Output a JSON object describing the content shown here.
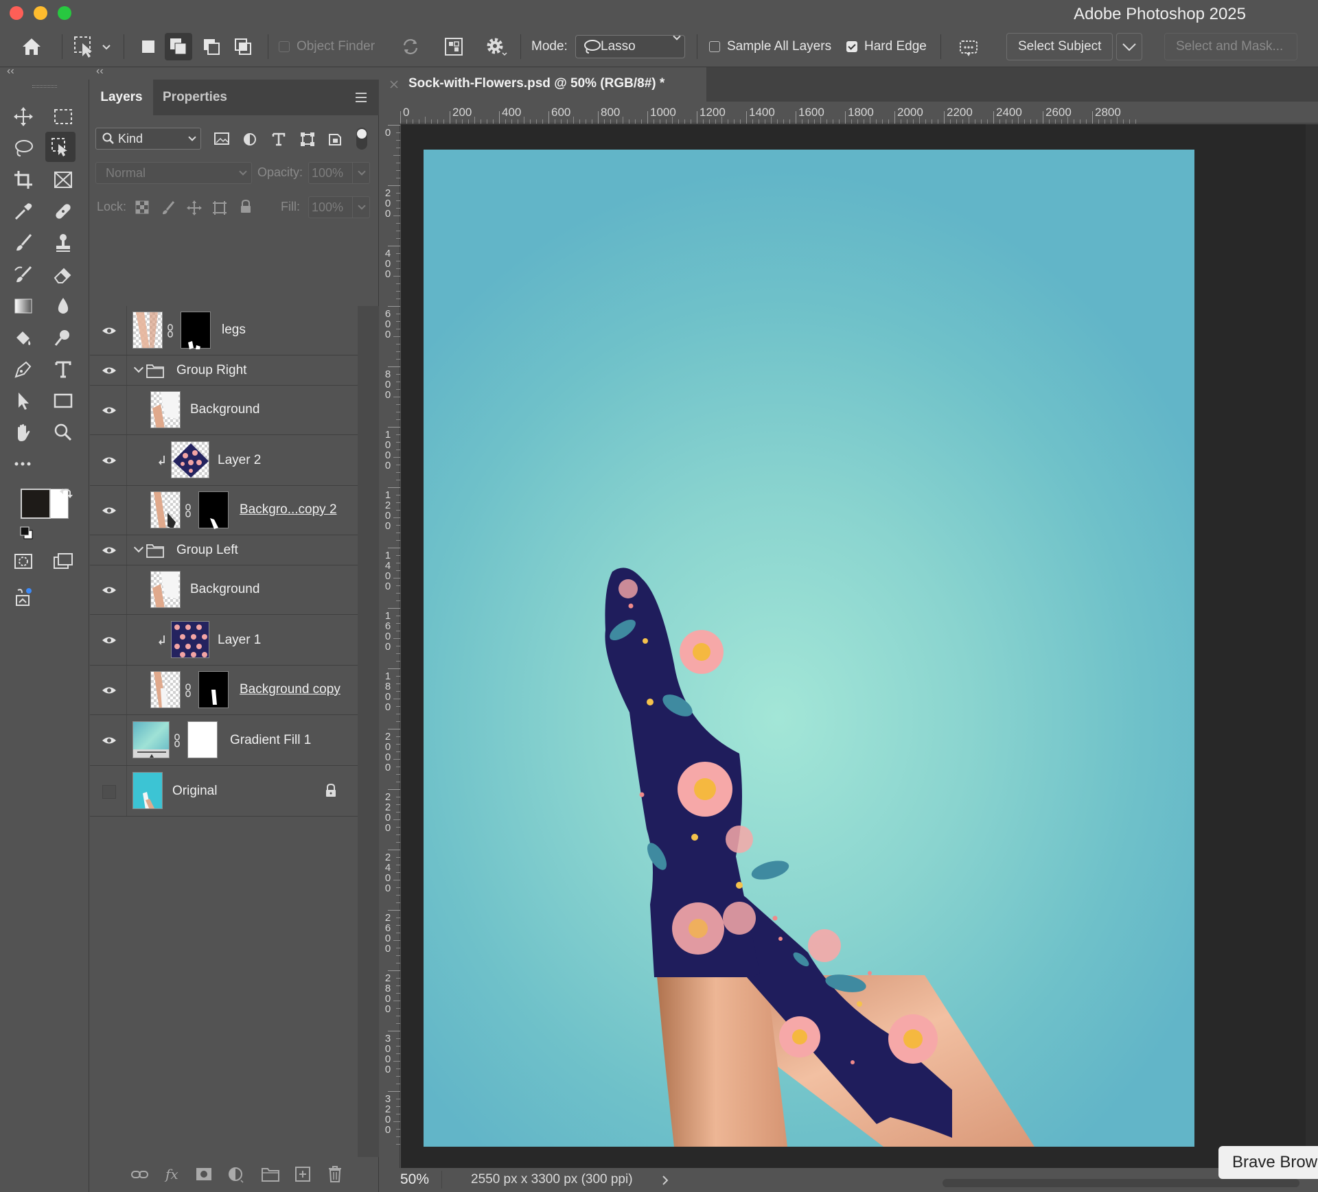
{
  "app": {
    "title": "Adobe Photoshop 2025"
  },
  "options": {
    "object_finder": "Object Finder",
    "mode_label": "Mode:",
    "mode_value": "Lasso",
    "sample_all_layers": "Sample All Layers",
    "sample_all_checked": false,
    "hard_edge": "Hard Edge",
    "hard_edge_checked": true,
    "select_subject": "Select Subject",
    "select_and_mask": "Select and Mask..."
  },
  "panel": {
    "tabs": [
      "Layers",
      "Properties"
    ],
    "active_tab": "Layers",
    "filter_kind": "Kind",
    "blend_mode": "Normal",
    "opacity_label": "Opacity:",
    "opacity_value": "100%",
    "lock_label": "Lock:",
    "fill_label": "Fill:",
    "fill_value": "100%",
    "layers": [
      {
        "name": "legs",
        "visible": true,
        "mask": true
      },
      {
        "name": "Group Right",
        "visible": true,
        "group": true
      },
      {
        "name": "Background",
        "visible": true
      },
      {
        "name": "Layer 2",
        "visible": true,
        "clipped": true
      },
      {
        "name": "Backgro...copy 2",
        "visible": true,
        "mask": true
      },
      {
        "name": "Group Left",
        "visible": true,
        "group": true
      },
      {
        "name": "Background",
        "visible": true
      },
      {
        "name": "Layer 1",
        "visible": true,
        "clipped": true
      },
      {
        "name": "Background copy",
        "visible": true,
        "mask": true
      },
      {
        "name": "Gradient Fill 1",
        "visible": true,
        "mask": true
      },
      {
        "name": "Original",
        "visible": false,
        "locked": true
      }
    ]
  },
  "document": {
    "tab_title": "Sock-with-Flowers.psd @ 50% (RGB/8#) *",
    "h_ruler": [
      "0",
      "200",
      "400",
      "600",
      "800",
      "1000",
      "1200",
      "1400",
      "1600",
      "1800",
      "2000",
      "2200",
      "2400",
      "2600",
      "2800"
    ],
    "v_ruler": [
      "0",
      "200",
      "400",
      "600",
      "800",
      "1000",
      "1200",
      "1400",
      "1600",
      "1800",
      "2000",
      "2200",
      "2400",
      "2600",
      "2800",
      "3000",
      "3200"
    ],
    "zoom": "50%",
    "doc_info": "2550 px x 3300 px (300 ppi)"
  },
  "tooltip": "Brave Brow",
  "colors": {
    "foreground": "#1e1b18",
    "background": "#ffffff",
    "accent_sock": "#1f1d5c",
    "flower_pink": "#f6a8a8",
    "flower_center": "#f5b840"
  }
}
